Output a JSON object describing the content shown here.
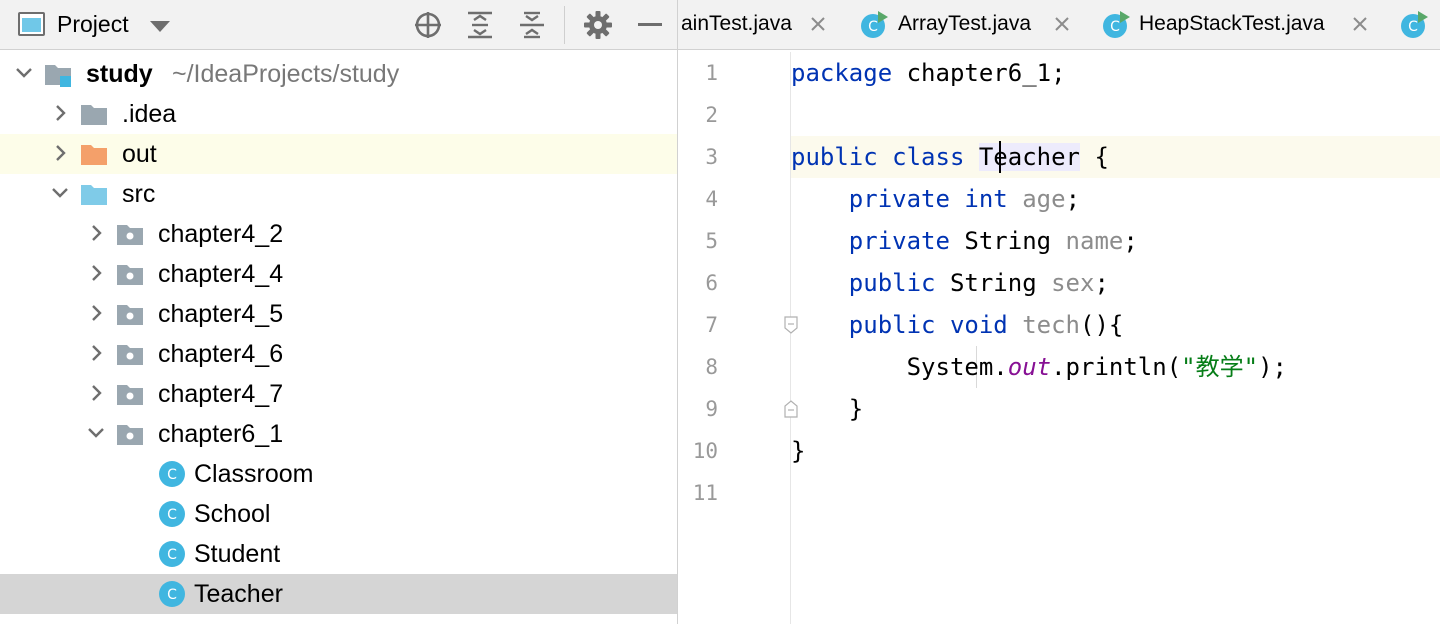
{
  "project_panel": {
    "title": "Project",
    "tree": [
      {
        "label": "study",
        "path": "~/IdeaProjects/study",
        "depth": 0,
        "expanded": true,
        "icon": "module-folder-icon"
      },
      {
        "label": ".idea",
        "depth": 1,
        "expanded": false,
        "icon": "folder-icon"
      },
      {
        "label": "out",
        "depth": 1,
        "expanded": false,
        "icon": "excluded-folder-icon"
      },
      {
        "label": "src",
        "depth": 1,
        "expanded": true,
        "icon": "source-folder-icon"
      },
      {
        "label": "chapter4_2",
        "depth": 2,
        "expanded": false,
        "icon": "package-icon"
      },
      {
        "label": "chapter4_4",
        "depth": 2,
        "expanded": false,
        "icon": "package-icon"
      },
      {
        "label": "chapter4_5",
        "depth": 2,
        "expanded": false,
        "icon": "package-icon"
      },
      {
        "label": "chapter4_6",
        "depth": 2,
        "expanded": false,
        "icon": "package-icon"
      },
      {
        "label": "chapter4_7",
        "depth": 2,
        "expanded": false,
        "icon": "package-icon"
      },
      {
        "label": "chapter6_1",
        "depth": 2,
        "expanded": true,
        "icon": "package-icon"
      },
      {
        "label": "Classroom",
        "depth": 3,
        "icon": "class-icon"
      },
      {
        "label": "School",
        "depth": 3,
        "icon": "class-icon"
      },
      {
        "label": "Student",
        "depth": 3,
        "icon": "class-icon"
      },
      {
        "label": "Teacher",
        "depth": 3,
        "icon": "class-icon",
        "selected": true
      }
    ]
  },
  "editor": {
    "tabs": [
      {
        "label": "ainTest.java",
        "icon": "none"
      },
      {
        "label": "ArrayTest.java",
        "icon": "runnable-class-icon"
      },
      {
        "label": "HeapStackTest.java",
        "icon": "runnable-class-icon"
      },
      {
        "label": "",
        "icon": "runnable-class-icon"
      }
    ],
    "line_numbers": [
      "1",
      "2",
      "3",
      "4",
      "5",
      "6",
      "7",
      "8",
      "9",
      "10",
      "11"
    ],
    "code": {
      "l1": {
        "kw": "package",
        "rest": " chapter6_1;"
      },
      "l3": {
        "kw": "public class",
        "id": "Teacher",
        "rest": " {"
      },
      "l4": {
        "kw": "private int",
        "fld": "age",
        "rest": ";"
      },
      "l5": {
        "kw": "private",
        "type": " String ",
        "fld": "name",
        "rest": ";"
      },
      "l6": {
        "kw": "public",
        "type": " String ",
        "fld": "sex",
        "rest": ";"
      },
      "l7": {
        "kw": "public void",
        "method": "tech",
        "rest": "(){"
      },
      "l8": {
        "cls": "System.",
        "static": "out",
        "call": ".println(",
        "str": "\"教学\"",
        "rest": ");"
      },
      "l9": {
        "rest": "}"
      },
      "l10": {
        "rest": "}"
      }
    }
  },
  "colors": {
    "keyword": "#0033b3",
    "field": "#871094",
    "string": "#067d17",
    "class_icon": "#40b6e0",
    "run_badge": "#59a869",
    "excluded_folder": "#f4a06a",
    "source_folder": "#7fcbe8",
    "selection": "#d5d5d5",
    "current_line": "#fcfaed"
  }
}
